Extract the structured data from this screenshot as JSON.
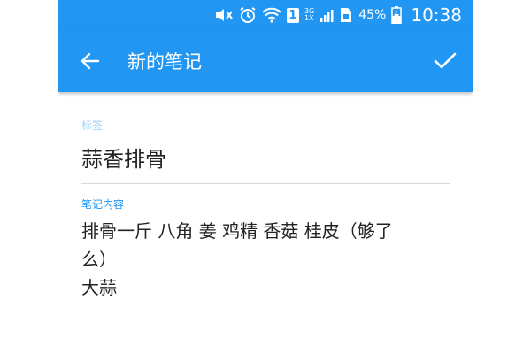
{
  "status_bar": {
    "network_primary": "3G",
    "network_secondary": "1X",
    "sim_badge": "1",
    "battery_percent": "45%",
    "time": "10:38"
  },
  "app_bar": {
    "title": "新的笔记"
  },
  "form": {
    "tag_label": "标签",
    "tag_value": "蒜香排骨",
    "content_label": "笔记内容",
    "content_value": "排骨一斤 八角 姜 鸡精 香菇 桂皮（够了\n么）\n大蒜"
  },
  "colors": {
    "primary": "#2196F3",
    "hint": "#9fd3f7"
  }
}
